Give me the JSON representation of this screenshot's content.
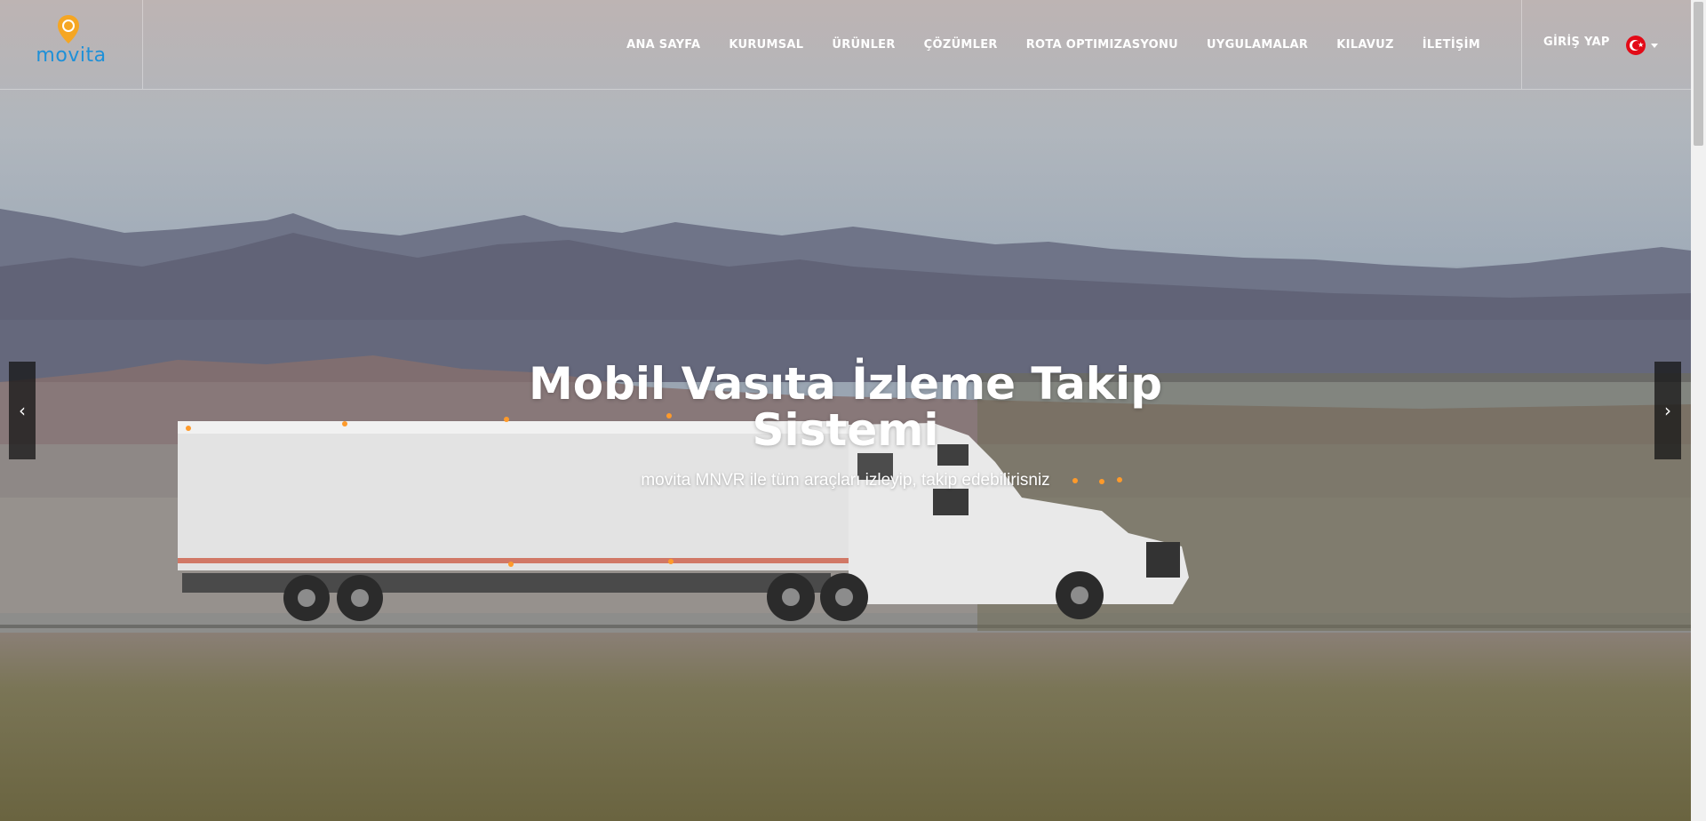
{
  "brand": {
    "name": "movita",
    "logo_color": "#1e90d8",
    "pin_color": "#f5a623"
  },
  "nav": {
    "items": [
      {
        "label": "ANA SAYFA"
      },
      {
        "label": "KURUMSAL"
      },
      {
        "label": "ÜRÜNLER"
      },
      {
        "label": "ÇÖZÜMLER"
      },
      {
        "label": "ROTA OPTIMIZASYONU"
      },
      {
        "label": "UYGULAMALAR"
      },
      {
        "label": "KILAVUZ"
      },
      {
        "label": "İLETİŞİM"
      }
    ],
    "login_label": "GİRİŞ YAP",
    "language_icon": "turkey-flag-icon"
  },
  "hero": {
    "title_line1": "Mobil Vasıta İzleme Takip",
    "title_line2": "Sistemi",
    "subtitle": "movita MNVR ile tüm araçları izleyip, takip edebilirisniz",
    "prev_icon": "chevron-left-icon",
    "next_icon": "chevron-right-icon"
  },
  "colors": {
    "text": "#ffffff",
    "flag_red": "#e30a17"
  }
}
